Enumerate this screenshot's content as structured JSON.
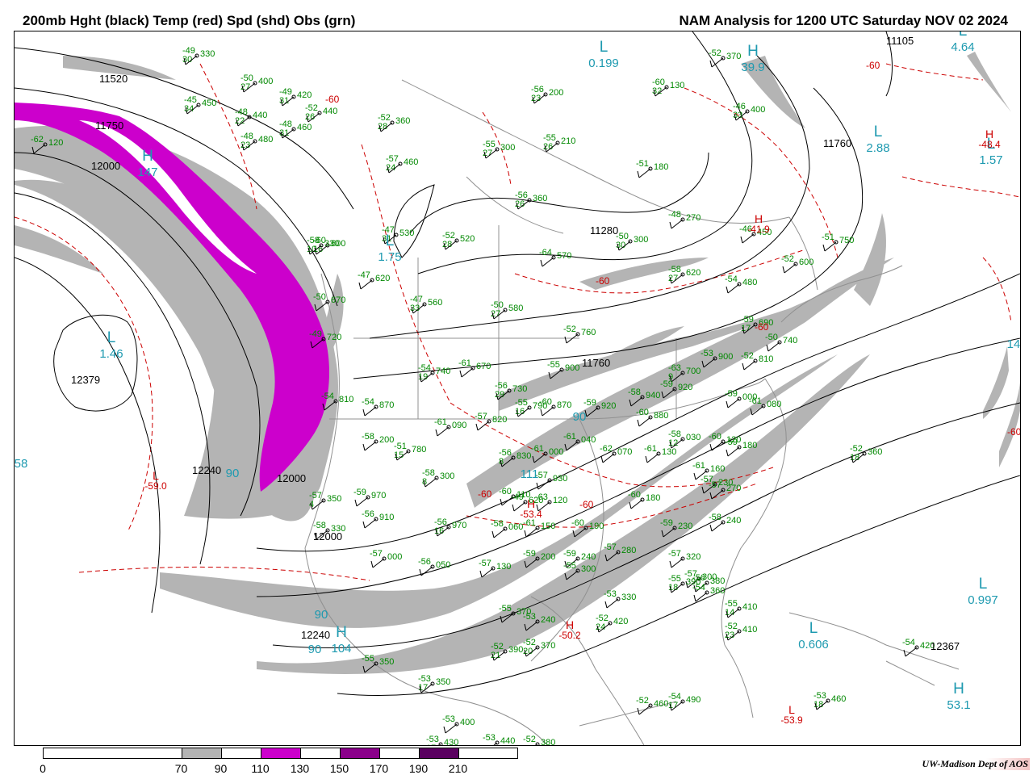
{
  "header": {
    "title_left": "200mb Hght (black) Temp (red) Spd (shd) Obs (grn)",
    "title_right": "NAM Analysis for 1200 UTC Saturday  NOV 02 2024"
  },
  "colors": {
    "height": "#000000",
    "temp": "#cc0000",
    "obs": "#008800",
    "center": "#1e9ab0",
    "spd_70": "#b4b4b4",
    "spd_110": "#cc00cc",
    "spd_150": "#8b008b",
    "spd_190": "#5a0060",
    "border": "#909090"
  },
  "colorbar": {
    "labels": [
      "0",
      "70",
      "90",
      "110",
      "130",
      "150",
      "170",
      "190",
      "210"
    ],
    "segments": [
      {
        "from": 0,
        "to": 70,
        "color": "#ffffff"
      },
      {
        "from": 70,
        "to": 90,
        "color": "#b4b4b4"
      },
      {
        "from": 90,
        "to": 110,
        "color": "#ffffff"
      },
      {
        "from": 110,
        "to": 130,
        "color": "#cc00cc"
      },
      {
        "from": 130,
        "to": 150,
        "color": "#ffffff"
      },
      {
        "from": 150,
        "to": 170,
        "color": "#8b008b"
      },
      {
        "from": 170,
        "to": 190,
        "color": "#ffffff"
      },
      {
        "from": 190,
        "to": 210,
        "color": "#5a0060"
      },
      {
        "from": 210,
        "to": 240,
        "color": "#ffffff"
      }
    ]
  },
  "height_labels": [
    "11520",
    "11750",
    "12000",
    "12379",
    "12240",
    "12000",
    "12000",
    "11760",
    "11280",
    "11760",
    "12240",
    "12367",
    "11105"
  ],
  "centers": [
    {
      "letter": "L",
      "value": "1.46"
    },
    {
      "letter": "H",
      "value": "147"
    },
    {
      "letter": "L",
      "value": "1.75"
    },
    {
      "letter": "L",
      "value": "0.199"
    },
    {
      "letter": "L",
      "value": "2.88"
    },
    {
      "letter": "L",
      "value": "1.57"
    },
    {
      "letter": "L",
      "value": "0.997"
    },
    {
      "letter": "L",
      "value": "0.606"
    },
    {
      "letter": "H",
      "value": "53.1"
    },
    {
      "letter": "H",
      "value": "104"
    },
    {
      "letter": "H",
      "value": "39.9"
    },
    {
      "letter": "L",
      "value": "4.64"
    }
  ],
  "speed_labels": [
    "90",
    "90",
    "90",
    "111",
    "90",
    "58",
    "14"
  ],
  "temp_centers": [
    {
      "letter": "L",
      "value": "-59.0"
    },
    {
      "letter": "H",
      "value": "-41.9"
    },
    {
      "letter": "H",
      "value": "-48.4"
    },
    {
      "letter": "H",
      "value": "-53.4"
    },
    {
      "letter": "H",
      "value": "-50.2"
    },
    {
      "letter": "L",
      "value": "-53.9"
    }
  ],
  "temp_labels": [
    "-60",
    "-60",
    "-60",
    "-60",
    "-60",
    "-60",
    "-60"
  ],
  "observations": [
    {
      "t": "-49",
      "d": "30",
      "h": "330"
    },
    {
      "t": "-50",
      "d": "27",
      "h": "400"
    },
    {
      "t": "-45",
      "d": "34",
      "h": "450"
    },
    {
      "t": "-49",
      "d": "31",
      "h": "420"
    },
    {
      "t": "-48",
      "d": "22",
      "h": "440"
    },
    {
      "t": "-52",
      "d": "26",
      "h": "440"
    },
    {
      "t": "-48",
      "d": "31",
      "h": "460"
    },
    {
      "t": "-48",
      "d": "23",
      "h": "480"
    },
    {
      "t": "-52",
      "d": "28",
      "h": "360"
    },
    {
      "t": "-57",
      "d": "24",
      "h": "460"
    },
    {
      "t": "-56",
      "d": "23",
      "h": "200"
    },
    {
      "t": "-55",
      "d": "26",
      "h": "210"
    },
    {
      "t": "-55",
      "d": "27",
      "h": "300"
    },
    {
      "t": "-51",
      "d": "",
      "h": "180"
    },
    {
      "t": "-60",
      "d": "32",
      "h": "130"
    },
    {
      "t": "-52",
      "d": "",
      "h": "370"
    },
    {
      "t": "-46",
      "d": "33",
      "h": "400"
    },
    {
      "t": "-56",
      "d": "26",
      "h": "360"
    },
    {
      "t": "-48",
      "d": "",
      "h": "270"
    },
    {
      "t": "-46",
      "d": "",
      "h": "450"
    },
    {
      "t": "-50",
      "d": "30",
      "h": "300"
    },
    {
      "t": "-51",
      "d": "",
      "h": "750"
    },
    {
      "t": "-47",
      "d": "31",
      "h": "530"
    },
    {
      "t": "-52",
      "d": "28",
      "h": "520"
    },
    {
      "t": "-64",
      "d": "",
      "h": "570"
    },
    {
      "t": "-60",
      "d": "16",
      "h": "600"
    },
    {
      "t": "-47",
      "d": "",
      "h": "620"
    },
    {
      "t": "-47",
      "d": "33",
      "h": "560"
    },
    {
      "t": "-50",
      "d": "27",
      "h": "580"
    },
    {
      "t": "-58",
      "d": "27",
      "h": "620"
    },
    {
      "t": "-54",
      "d": "",
      "h": "480"
    },
    {
      "t": "-52",
      "d": "",
      "h": "600"
    },
    {
      "t": "-50",
      "d": "",
      "h": "670"
    },
    {
      "t": "-49",
      "d": "",
      "h": "720"
    },
    {
      "t": "-52",
      "d": "",
      "h": "760"
    },
    {
      "t": "-59",
      "d": "17",
      "h": "690"
    },
    {
      "t": "-50",
      "d": "",
      "h": "740"
    },
    {
      "t": "-53",
      "d": "",
      "h": "900"
    },
    {
      "t": "-52",
      "d": "",
      "h": "810"
    },
    {
      "t": "-55",
      "d": "",
      "h": "900"
    },
    {
      "t": "-54",
      "d": "19",
      "h": "740"
    },
    {
      "t": "-61",
      "d": "",
      "h": "670"
    },
    {
      "t": "-63",
      "d": "9",
      "h": "700"
    },
    {
      "t": "-54",
      "d": "",
      "h": "810"
    },
    {
      "t": "-54",
      "d": "",
      "h": "870"
    },
    {
      "t": "-56",
      "d": "29",
      "h": "730"
    },
    {
      "t": "-55",
      "d": "16",
      "h": "790"
    },
    {
      "t": "-60",
      "d": "",
      "h": "870"
    },
    {
      "t": "-59",
      "d": "",
      "h": "920"
    },
    {
      "t": "-58",
      "d": "",
      "h": "940"
    },
    {
      "t": "-59",
      "d": "",
      "h": "920"
    },
    {
      "t": "-59",
      "d": "",
      "h": "000"
    },
    {
      "t": "-61",
      "d": "",
      "h": "080"
    },
    {
      "t": "-61",
      "d": "",
      "h": "090"
    },
    {
      "t": "-57",
      "d": "",
      "h": "820"
    },
    {
      "t": "-60",
      "d": "",
      "h": "880"
    },
    {
      "t": "-58",
      "d": "12",
      "h": "030"
    },
    {
      "t": "-60",
      "d": "",
      "h": "120"
    },
    {
      "t": "-59",
      "d": "",
      "h": "180"
    },
    {
      "t": "-58",
      "d": "",
      "h": "200"
    },
    {
      "t": "-51",
      "d": "15",
      "h": "780"
    },
    {
      "t": "-56",
      "d": "8",
      "h": "830"
    },
    {
      "t": "-61",
      "d": "",
      "h": "000"
    },
    {
      "t": "-61",
      "d": "",
      "h": "040"
    },
    {
      "t": "-62",
      "d": "",
      "h": "070"
    },
    {
      "t": "-61",
      "d": "",
      "h": "130"
    },
    {
      "t": "-61",
      "d": "",
      "h": "160"
    },
    {
      "t": "-57",
      "d": "",
      "h": "230"
    },
    {
      "t": "-57",
      "d": "",
      "h": "270"
    },
    {
      "t": "-58",
      "d": "8",
      "h": "300"
    },
    {
      "t": "-57",
      "d": "",
      "h": "930"
    },
    {
      "t": "-60",
      "d": "",
      "h": "110"
    },
    {
      "t": "-63",
      "d": "",
      "h": "120"
    },
    {
      "t": "-60",
      "d": "",
      "h": "180"
    },
    {
      "t": "-58",
      "d": "",
      "h": "240"
    },
    {
      "t": "-57",
      "d": "4",
      "h": "350"
    },
    {
      "t": "-59",
      "d": "",
      "h": "970"
    },
    {
      "t": "-56",
      "d": "",
      "h": "910"
    },
    {
      "t": "-56",
      "d": "16",
      "h": "970"
    },
    {
      "t": "-58",
      "d": "",
      "h": "060"
    },
    {
      "t": "-61",
      "d": "",
      "h": "150"
    },
    {
      "t": "-60",
      "d": "",
      "h": "190"
    },
    {
      "t": "-59",
      "d": "",
      "h": "230"
    },
    {
      "t": "-58",
      "d": "",
      "h": "330"
    },
    {
      "t": "-57",
      "d": "",
      "h": "000"
    },
    {
      "t": "-56",
      "d": "",
      "h": "050"
    },
    {
      "t": "-57",
      "d": "",
      "h": "130"
    },
    {
      "t": "-59",
      "d": "",
      "h": "200"
    },
    {
      "t": "-59",
      "d": "",
      "h": "240"
    },
    {
      "t": "-57",
      "d": "",
      "h": "280"
    },
    {
      "t": "-57",
      "d": "",
      "h": "320"
    },
    {
      "t": "-57",
      "d": "",
      "h": "300"
    },
    {
      "t": "-56",
      "d": "",
      "h": "380"
    },
    {
      "t": "-55",
      "d": "18",
      "h": "390"
    },
    {
      "t": "-55",
      "d": "",
      "h": "300"
    },
    {
      "t": "-53",
      "d": "",
      "h": "330"
    },
    {
      "t": "-54",
      "d": "",
      "h": "360"
    },
    {
      "t": "-55",
      "d": "14",
      "h": "410"
    },
    {
      "t": "-52",
      "d": "23",
      "h": "410"
    },
    {
      "t": "-52",
      "d": "24",
      "h": "420"
    },
    {
      "t": "-55",
      "d": "",
      "h": "370"
    },
    {
      "t": "-53",
      "d": "",
      "h": "240"
    },
    {
      "t": "-55",
      "d": "",
      "h": "350"
    },
    {
      "t": "-53",
      "d": "17",
      "h": "350"
    },
    {
      "t": "-52",
      "d": "21",
      "h": "390"
    },
    {
      "t": "-52",
      "d": "20",
      "h": "370"
    },
    {
      "t": "-53",
      "d": "",
      "h": "400"
    },
    {
      "t": "-53",
      "d": "17",
      "h": "430"
    },
    {
      "t": "-53",
      "d": "",
      "h": "440"
    },
    {
      "t": "-52",
      "d": "",
      "h": "380"
    },
    {
      "t": "-52",
      "d": "",
      "h": "460"
    },
    {
      "t": "-54",
      "d": "17",
      "h": "490"
    },
    {
      "t": "-53",
      "d": "18",
      "h": "460"
    },
    {
      "t": "-54",
      "d": "",
      "h": "420"
    },
    {
      "t": "-52",
      "d": "18",
      "h": "360"
    },
    {
      "t": "-58",
      "d": "10",
      "h": "330"
    },
    {
      "t": "-49",
      "d": "",
      "h": "620"
    },
    {
      "t": "-62",
      "d": "",
      "h": "120"
    }
  ],
  "credit": {
    "text": "UW-Madison  Dept of AOS"
  }
}
